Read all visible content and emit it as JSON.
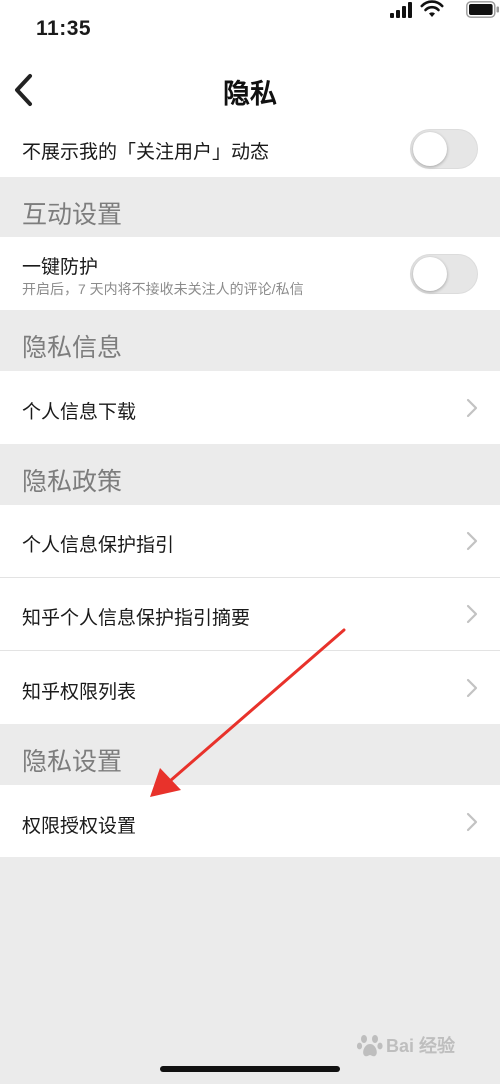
{
  "status_bar": {
    "time": "11:35"
  },
  "header": {
    "title": "隐私"
  },
  "rows": {
    "hide_follow": {
      "label": "不展示我的「关注用户」动态",
      "toggle_on": false
    },
    "interaction_header": "互动设置",
    "one_key_protect": {
      "label": "一键防护",
      "sub": "开启后，7 天内将不接收未关注人的评论/私信",
      "toggle_on": false
    },
    "privacy_info_header": "隐私信息",
    "personal_info_download": "个人信息下载",
    "privacy_policy_header": "隐私政策",
    "protection_guide": "个人信息保护指引",
    "protection_guide_summary": "知乎个人信息保护指引摘要",
    "permission_list": "知乎权限列表",
    "privacy_settings_header": "隐私设置",
    "permission_settings": "权限授权设置"
  },
  "watermark": {
    "text": "Bai 经验"
  },
  "colors": {
    "annotation_arrow": "#e8322b",
    "background": "#ebebeb"
  }
}
